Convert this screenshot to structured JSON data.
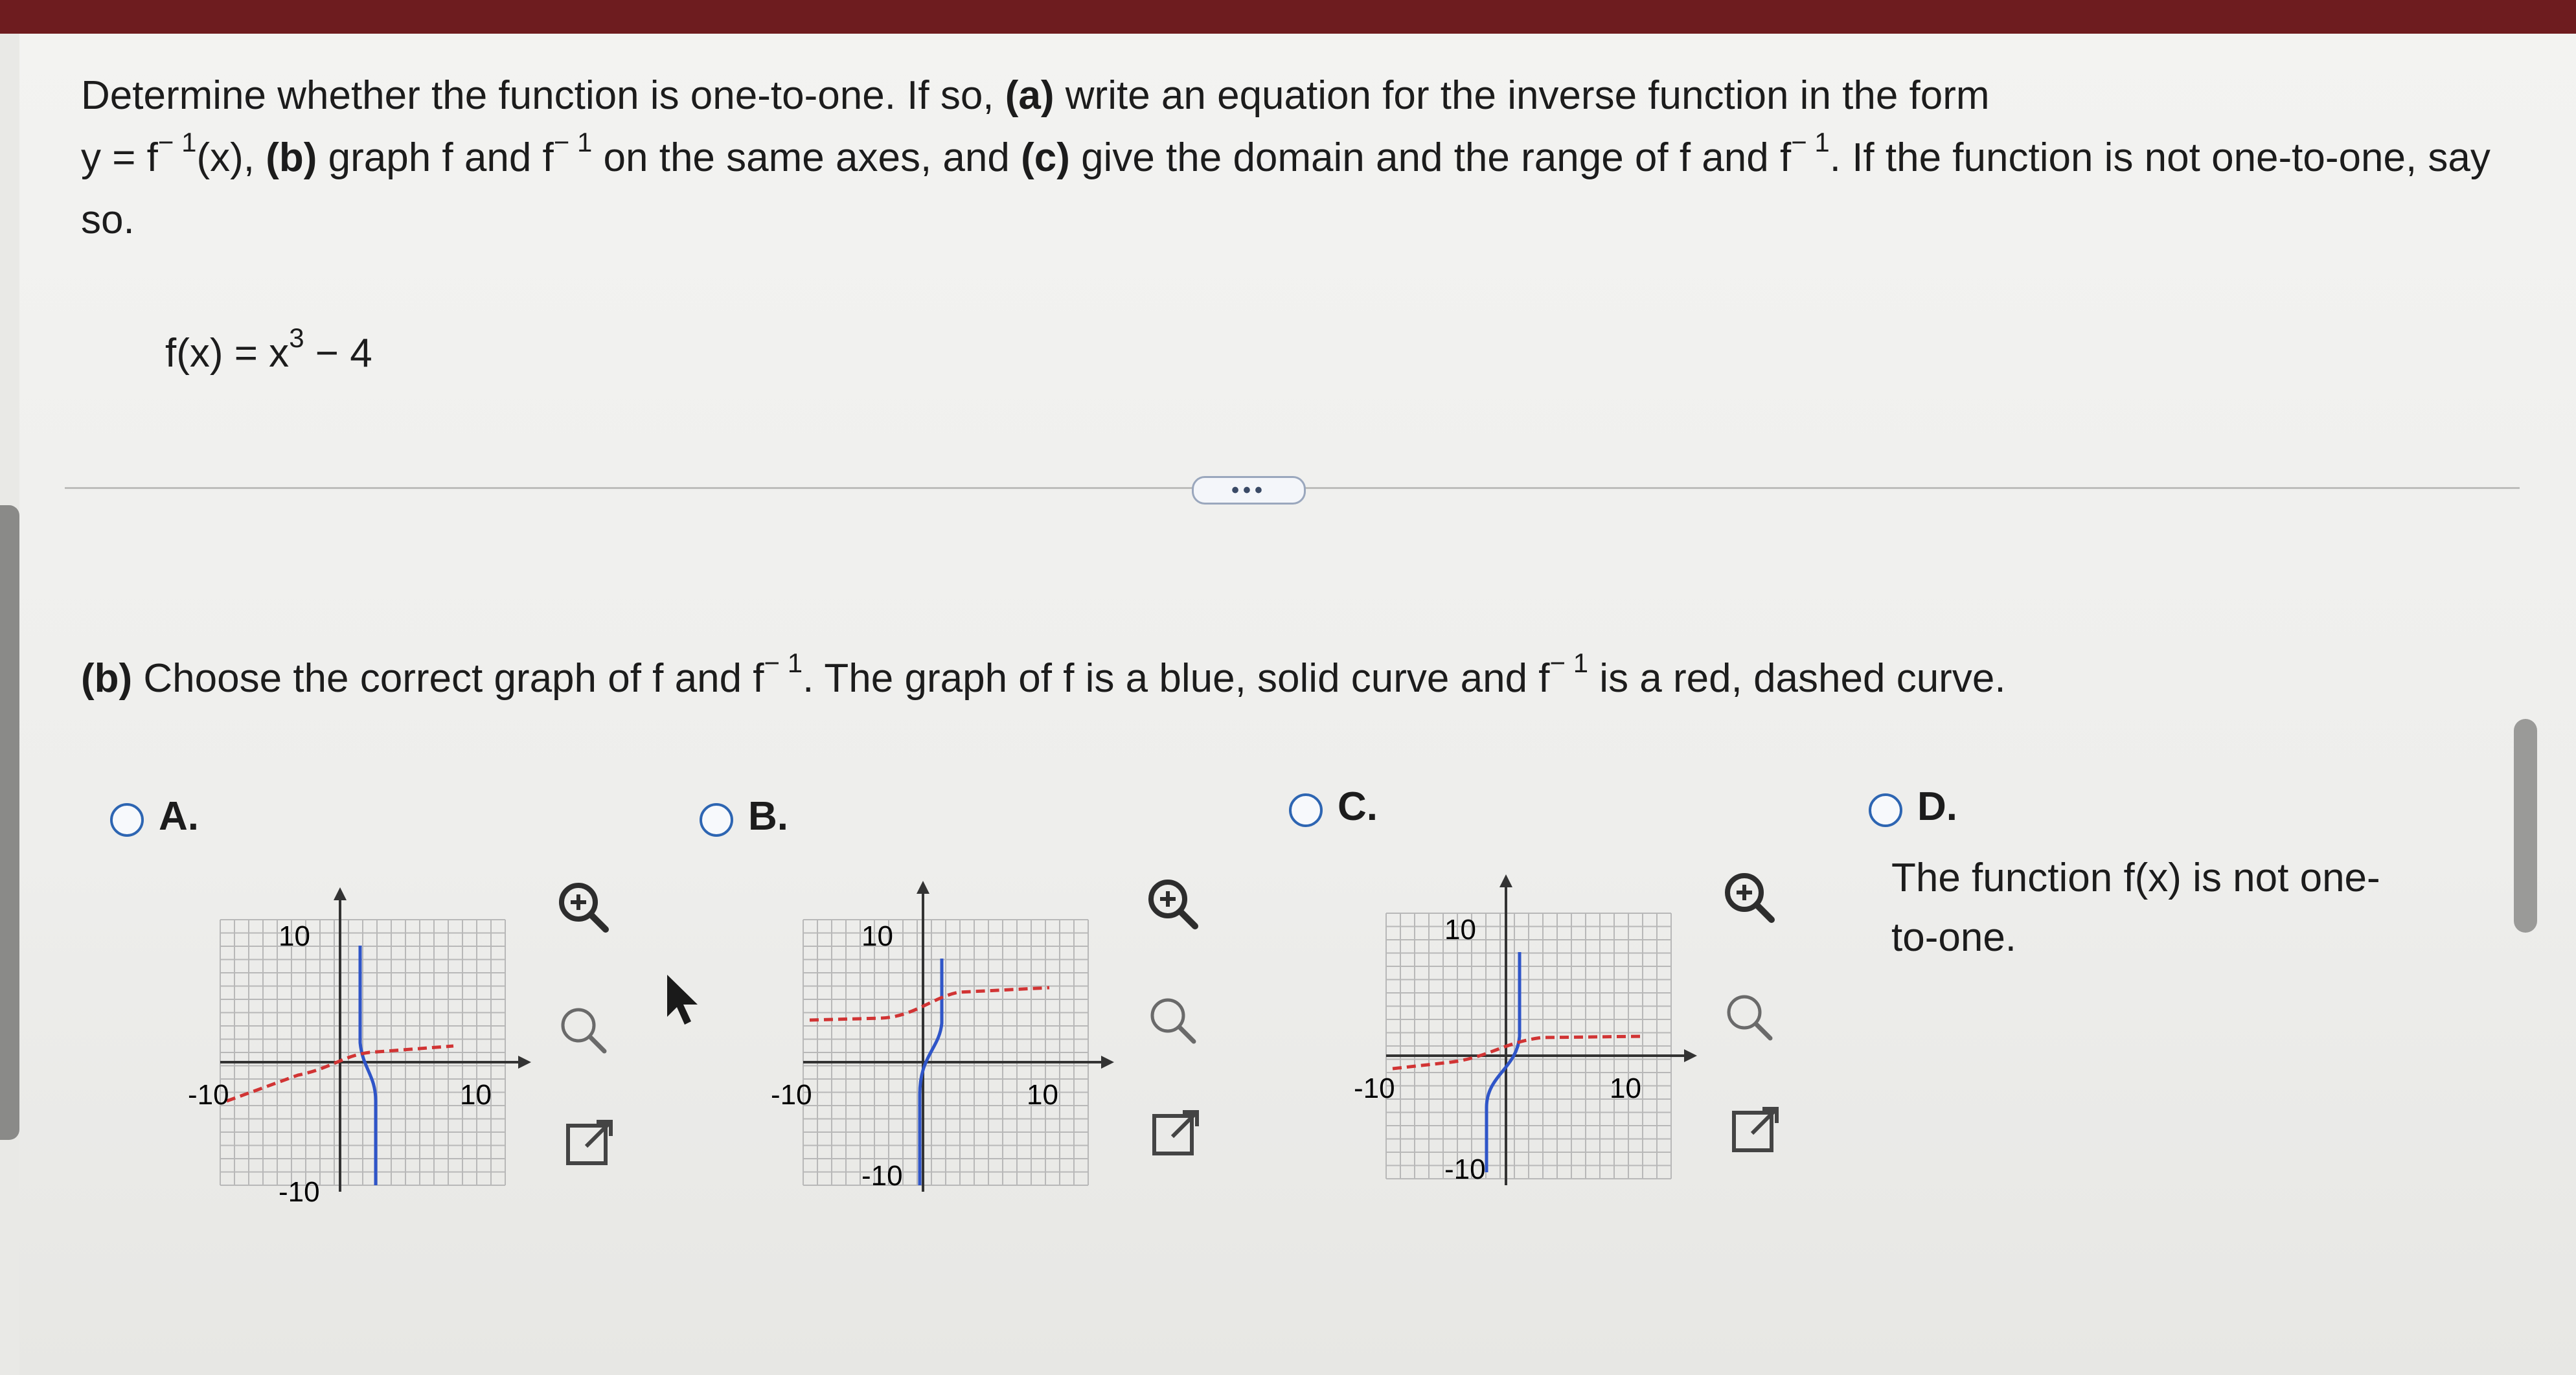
{
  "question": {
    "line1": "Determine whether the function is one-to-one. If so, ",
    "a_label": "(a)",
    "a_text": " write an equation for the inverse function in the form",
    "y_eq": "y = f",
    "inv_exp": "− 1",
    "x_part": "(x), ",
    "b_label": "(b)",
    "b_text": " graph f and f",
    "b_text2": " on the same axes, and ",
    "c_label": "(c)",
    "c_text": " give the domain and the range of f and f",
    "tail": ". If the function is not one-to-one, say so."
  },
  "function": {
    "lhs": "f(x) = x",
    "exp": "3",
    "rhs": " − 4"
  },
  "more_button": "•••",
  "part_b": {
    "label": "(b)",
    "text1": " Choose the correct graph of f and f",
    "text2": ". The graph of f is a blue, solid curve and f",
    "text3": " is a red, dashed curve."
  },
  "options": [
    {
      "letter": "A."
    },
    {
      "letter": "B."
    },
    {
      "letter": "C."
    },
    {
      "letter": "D.",
      "text": "The function f(x) is not one-to-one."
    }
  ],
  "axis_labels": {
    "pos": "10",
    "neg": "-10"
  },
  "icons": [
    "zoom-in-icon",
    "zoom-out-icon",
    "expand-icon"
  ],
  "colors": {
    "blue_curve": "#2f55c8",
    "red_curve": "#d13434",
    "radio": "#2d65b2"
  }
}
